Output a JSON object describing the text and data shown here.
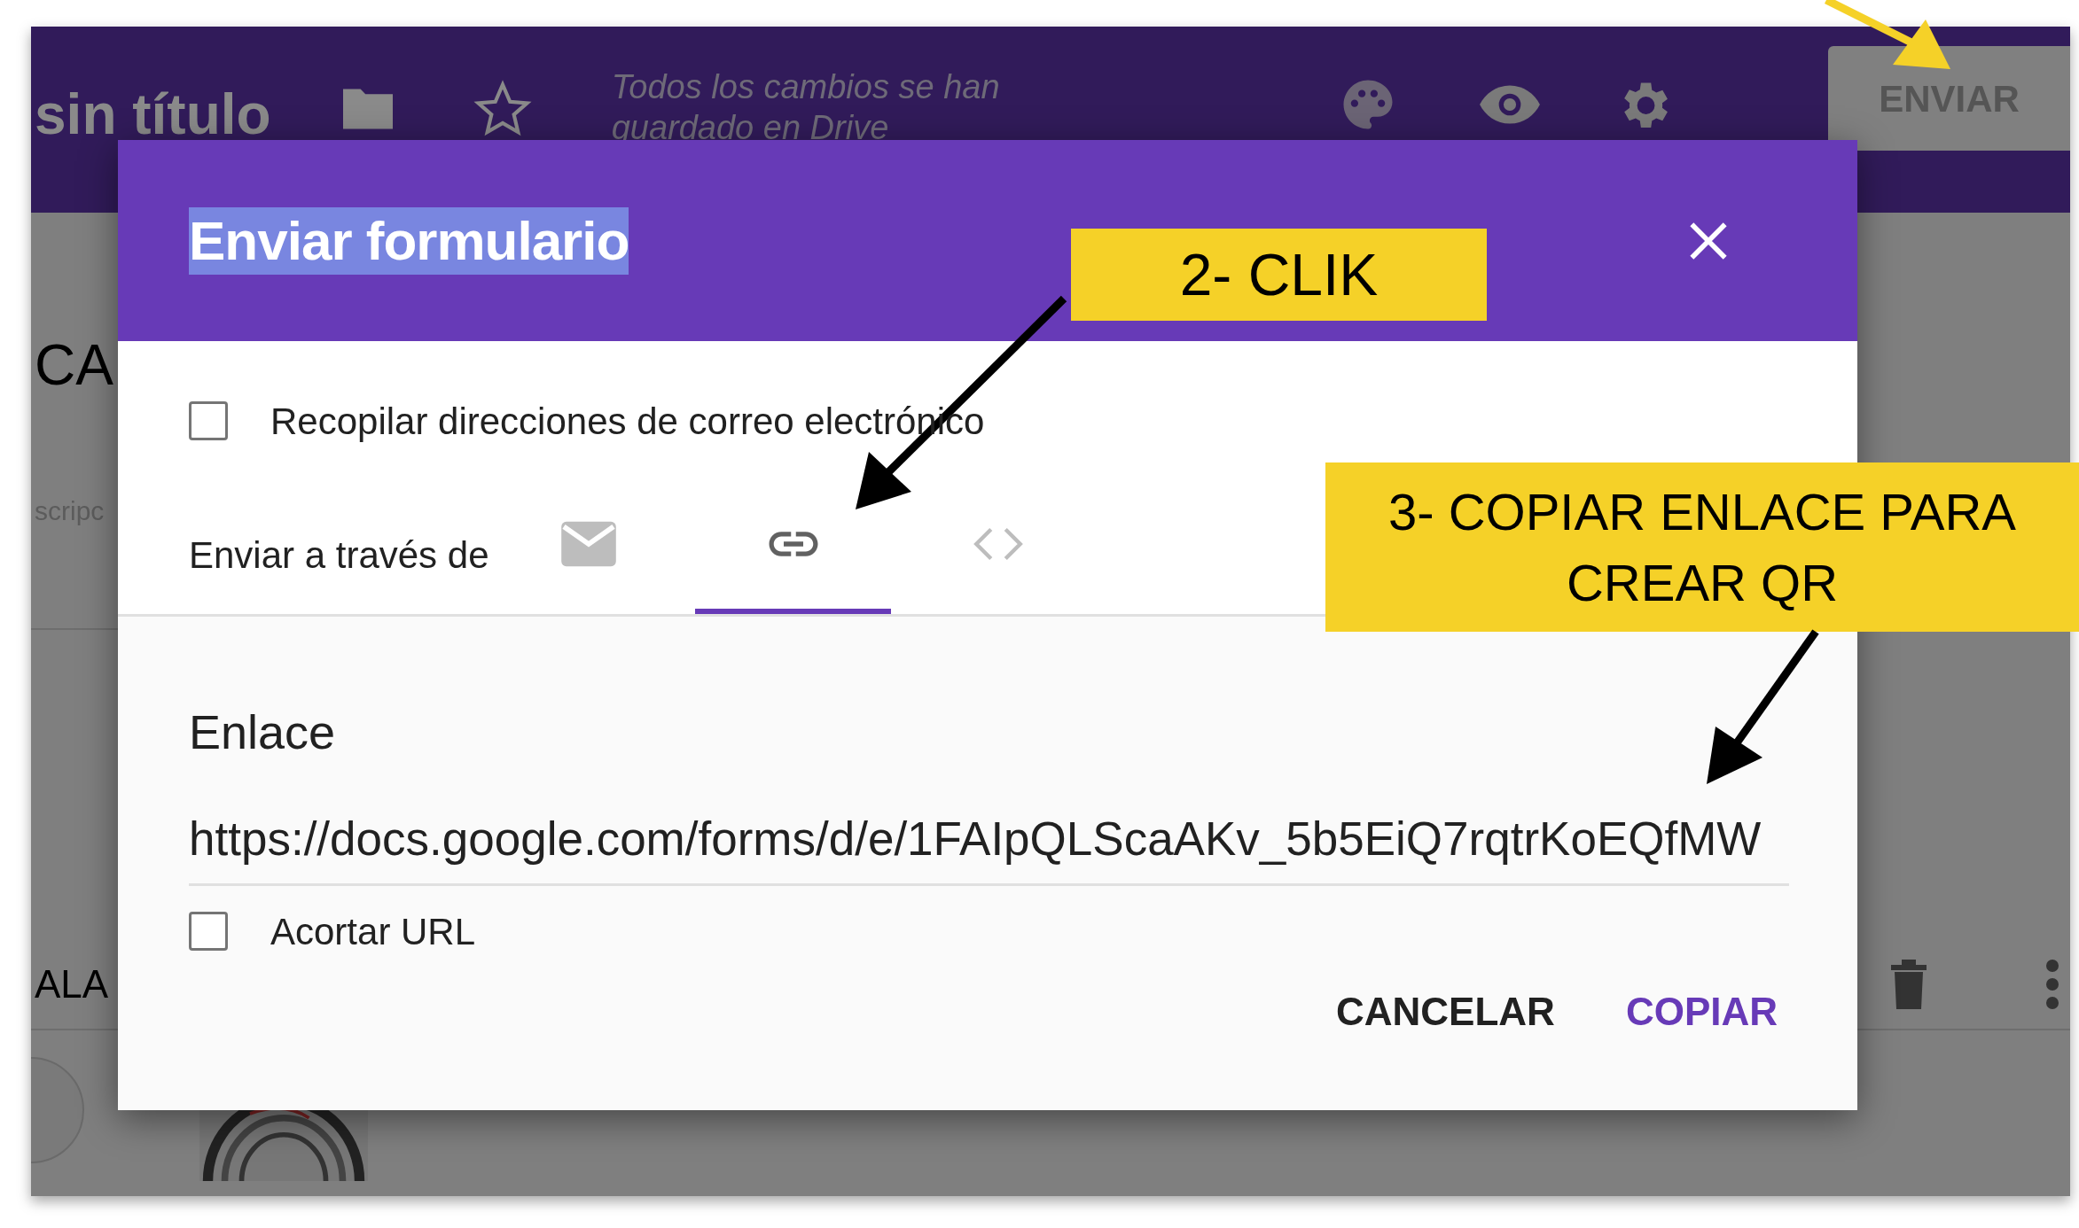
{
  "app_bar": {
    "title": "sin título",
    "save_status": "Todos los cambios se han guardado en Drive",
    "send_button": "ENVIAR"
  },
  "background": {
    "heading": "CA",
    "description": "scripc",
    "question": "ALA"
  },
  "dialog": {
    "title": "Enviar formulario",
    "title_selected": true,
    "collect_emails": {
      "label": "Recopilar direcciones de correo electrónico",
      "checked": false
    },
    "send_via_label": "Enviar a través de",
    "tabs": [
      {
        "kind": "email",
        "selected": false
      },
      {
        "kind": "link",
        "selected": true
      },
      {
        "kind": "embed",
        "selected": false
      }
    ],
    "section_title": "Enlace",
    "link": "https://docs.google.com/forms/d/e/1FAIpQLScaAKv_5b5EiQ7rqtrKoEQfMW",
    "shorten_url": {
      "label": "Acortar URL",
      "checked": false
    },
    "buttons": [
      {
        "label": "CANCELAR",
        "kind": "secondary"
      },
      {
        "label": "COPIAR",
        "kind": "primary"
      }
    ]
  },
  "annotations": [
    {
      "text": "2- CLIK"
    },
    {
      "text": "3- COPIAR ENLACE PARA CREAR QR"
    }
  ]
}
